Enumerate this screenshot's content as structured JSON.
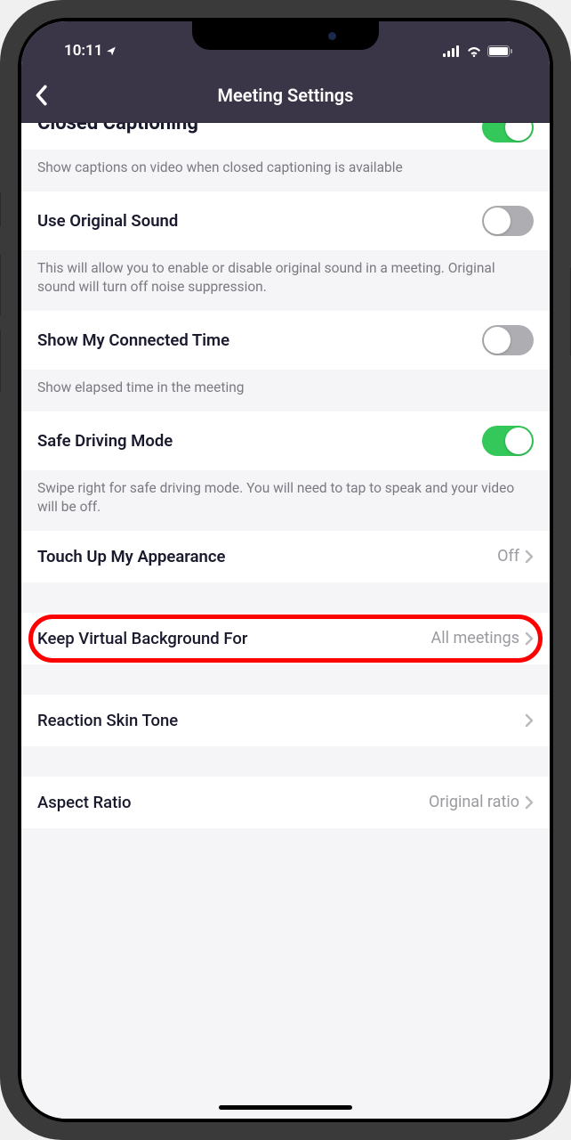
{
  "status": {
    "time": "10:11",
    "location_icon": "➤"
  },
  "nav": {
    "title": "Meeting Settings"
  },
  "rows": {
    "closed_captioning": {
      "title": "Closed Captioning",
      "desc": "Show captions on video when closed captioning is available",
      "toggle": true
    },
    "original_sound": {
      "title": "Use Original Sound",
      "desc": "This will allow you to enable or disable original sound in a meeting. Original sound will turn off noise suppression.",
      "toggle": false
    },
    "connected_time": {
      "title": "Show My Connected Time",
      "desc": "Show elapsed time in the meeting",
      "toggle": false
    },
    "safe_driving": {
      "title": "Safe Driving Mode",
      "desc": "Swipe right for safe driving mode. You will need to tap to speak and your video will be off.",
      "toggle": true
    },
    "touch_up": {
      "title": "Touch Up My Appearance",
      "value": "Off"
    },
    "virtual_bg": {
      "title": "Keep Virtual Background For",
      "value": "All meetings"
    },
    "reaction_skin": {
      "title": "Reaction Skin Tone",
      "value": ""
    },
    "aspect_ratio": {
      "title": "Aspect Ratio",
      "value": "Original ratio"
    }
  }
}
